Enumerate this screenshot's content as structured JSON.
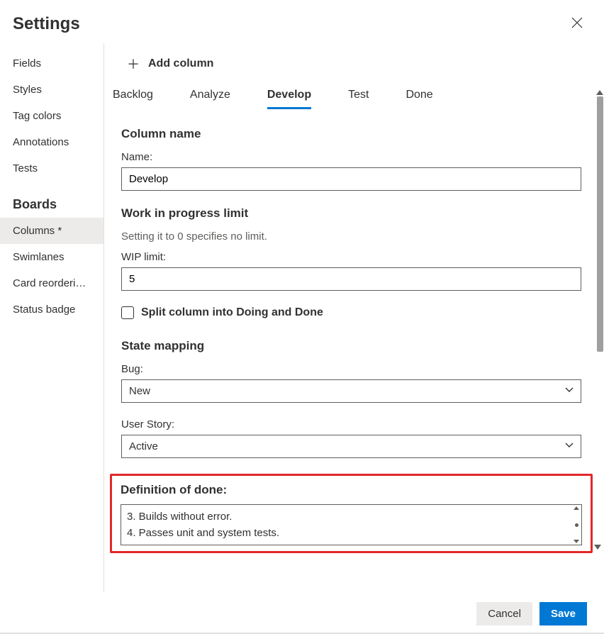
{
  "title": "Settings",
  "sidebar": {
    "top_items": [
      {
        "label": "Fields"
      },
      {
        "label": "Styles"
      },
      {
        "label": "Tag colors"
      },
      {
        "label": "Annotations"
      },
      {
        "label": "Tests"
      }
    ],
    "group_label": "Boards",
    "board_items": [
      {
        "label": "Columns *",
        "active": true
      },
      {
        "label": "Swimlanes"
      },
      {
        "label": "Card reorderi…"
      },
      {
        "label": "Status badge"
      }
    ]
  },
  "add_column_label": "Add column",
  "tabs": [
    {
      "label": "Backlog"
    },
    {
      "label": "Analyze"
    },
    {
      "label": "Develop",
      "active": true
    },
    {
      "label": "Test"
    },
    {
      "label": "Done"
    }
  ],
  "form": {
    "column_name_title": "Column name",
    "name_label": "Name:",
    "name_value": "Develop",
    "wip_title": "Work in progress limit",
    "wip_helper": "Setting it to 0 specifies no limit.",
    "wip_label": "WIP limit:",
    "wip_value": "5",
    "split_label": "Split column into Doing and Done",
    "state_title": "State mapping",
    "bug_label": "Bug:",
    "bug_value": "New",
    "story_label": "User Story:",
    "story_value": "Active",
    "dod_title": "Definition of done:",
    "dod_lines": [
      "3. Builds without error.",
      "4. Passes unit and system tests."
    ]
  },
  "footer": {
    "cancel": "Cancel",
    "save": "Save"
  }
}
